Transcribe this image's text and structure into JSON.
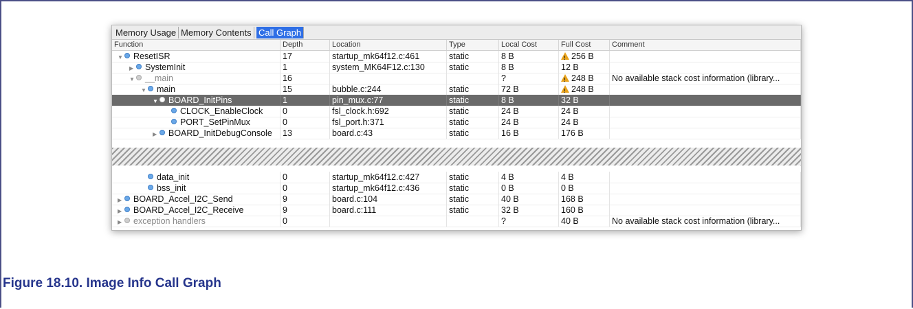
{
  "tabs": [
    {
      "label": "Memory Usage",
      "active": false
    },
    {
      "label": "Memory Contents",
      "active": false
    },
    {
      "label": "Call Graph",
      "active": true
    }
  ],
  "columns": [
    "Function",
    "Depth",
    "Location",
    "Type",
    "Local Cost",
    "Full Cost",
    "Comment"
  ],
  "rows": [
    {
      "function": "ResetISR",
      "indent": 0,
      "twisty": "expanded",
      "depth": "17",
      "location": "startup_mk64f12.c:461",
      "type": "static",
      "local_cost": "8 B",
      "full_cost": "256 B",
      "warn": true,
      "comment": "",
      "dim": false,
      "selected": false
    },
    {
      "function": "SystemInit",
      "indent": 1,
      "twisty": "collapsed",
      "depth": "1",
      "location": "system_MK64F12.c:130",
      "type": "static",
      "local_cost": "8 B",
      "full_cost": "12 B",
      "warn": false,
      "comment": "",
      "dim": false,
      "selected": false
    },
    {
      "function": "__main",
      "indent": 1,
      "twisty": "expanded",
      "depth": "16",
      "location": "",
      "type": "",
      "local_cost": "?",
      "full_cost": "248 B",
      "warn": true,
      "comment": "No available stack cost information (library...",
      "dim": true,
      "selected": false
    },
    {
      "function": "main",
      "indent": 2,
      "twisty": "expanded",
      "depth": "15",
      "location": "bubble.c:244",
      "type": "static",
      "local_cost": "72 B",
      "full_cost": "248 B",
      "warn": true,
      "comment": "",
      "dim": false,
      "selected": false
    },
    {
      "function": "BOARD_InitPins",
      "indent": 3,
      "twisty": "expanded",
      "depth": "1",
      "location": "pin_mux.c:77",
      "type": "static",
      "local_cost": "8 B",
      "full_cost": "32 B",
      "warn": false,
      "comment": "",
      "dim": false,
      "selected": true
    },
    {
      "function": "CLOCK_EnableClock",
      "indent": 4,
      "twisty": "none",
      "depth": "0",
      "location": "fsl_clock.h:692",
      "type": "static",
      "local_cost": "24 B",
      "full_cost": "24 B",
      "warn": false,
      "comment": "",
      "dim": false,
      "selected": false
    },
    {
      "function": "PORT_SetPinMux",
      "indent": 4,
      "twisty": "none",
      "depth": "0",
      "location": "fsl_port.h:371",
      "type": "static",
      "local_cost": "24 B",
      "full_cost": "24 B",
      "warn": false,
      "comment": "",
      "dim": false,
      "selected": false
    },
    {
      "function": "BOARD_InitDebugConsole",
      "indent": 3,
      "twisty": "collapsed",
      "depth": "13",
      "location": "board.c:43",
      "type": "static",
      "local_cost": "16 B",
      "full_cost": "176 B",
      "warn": false,
      "comment": "",
      "dim": false,
      "selected": false
    },
    {
      "function": "data_init",
      "indent": 2,
      "twisty": "none",
      "depth": "0",
      "location": "startup_mk64f12.c:427",
      "type": "static",
      "local_cost": "4 B",
      "full_cost": "4 B",
      "warn": false,
      "comment": "",
      "dim": false,
      "selected": false
    },
    {
      "function": "bss_init",
      "indent": 2,
      "twisty": "none",
      "depth": "0",
      "location": "startup_mk64f12.c:436",
      "type": "static",
      "local_cost": "0 B",
      "full_cost": "0 B",
      "warn": false,
      "comment": "",
      "dim": false,
      "selected": false
    },
    {
      "function": "BOARD_Accel_I2C_Send",
      "indent": 0,
      "twisty": "collapsed",
      "depth": "9",
      "location": "board.c:104",
      "type": "static",
      "local_cost": "40 B",
      "full_cost": "168 B",
      "warn": false,
      "comment": "",
      "dim": false,
      "selected": false
    },
    {
      "function": "BOARD_Accel_I2C_Receive",
      "indent": 0,
      "twisty": "collapsed",
      "depth": "9",
      "location": "board.c:111",
      "type": "static",
      "local_cost": "32 B",
      "full_cost": "160 B",
      "warn": false,
      "comment": "",
      "dim": false,
      "selected": false
    },
    {
      "function": "exception handlers",
      "indent": 0,
      "twisty": "collapsed",
      "depth": "0",
      "location": "",
      "type": "",
      "local_cost": "?",
      "full_cost": "40 B",
      "warn": false,
      "comment": "No available stack cost information (library...",
      "dim": true,
      "selected": false
    }
  ],
  "caption": "Figure 18.10. Image Info Call Graph"
}
